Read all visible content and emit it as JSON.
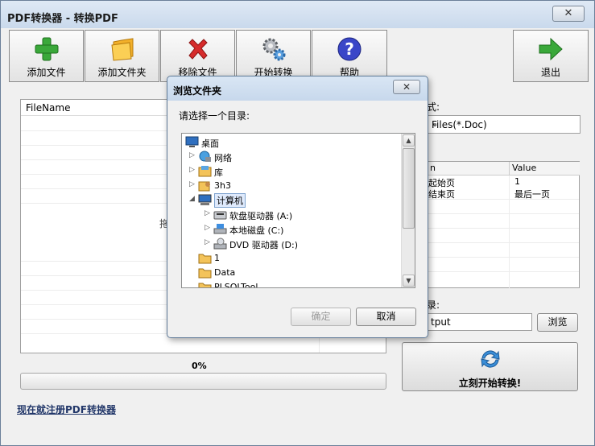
{
  "window": {
    "title": "PDF转换器 - 转换PDF",
    "close_glyph": "✕"
  },
  "toolbar": {
    "add_file": "添加文件",
    "add_folder": "添加文件夹",
    "remove_file": "移除文件",
    "start_convert": "开始转换",
    "help": "帮助",
    "exit": "退出"
  },
  "file_list": {
    "header": "FileName",
    "drop_hint": "拖"
  },
  "progress": {
    "percent_label": "0%",
    "value": 0
  },
  "register_link": "现在就注册PDF转换器",
  "format": {
    "label": "式:",
    "selected": "Files(*.Doc)"
  },
  "properties": {
    "col_name": "n",
    "col_value": "Value",
    "rows": [
      {
        "name": "起始页",
        "value": "1"
      },
      {
        "name": "结束页",
        "value": "最后一页"
      }
    ]
  },
  "output": {
    "label": "录:",
    "value": "tput",
    "browse": "浏览"
  },
  "start_button": "立刻开始转换!",
  "dialog": {
    "title": "浏览文件夹",
    "close_glyph": "✕",
    "prompt": "请选择一个目录:",
    "tree": [
      {
        "label": "桌面",
        "icon": "desktop-icon",
        "expander": ""
      },
      {
        "label": "网络",
        "icon": "network-icon",
        "expander": "▷"
      },
      {
        "label": "库",
        "icon": "library-icon",
        "expander": "▷"
      },
      {
        "label": "3h3",
        "icon": "user-folder-icon",
        "expander": "▷"
      },
      {
        "label": "计算机",
        "icon": "computer-icon",
        "expander": "◢"
      },
      {
        "label": "软盘驱动器 (A:)",
        "icon": "floppy-icon",
        "expander": "▷"
      },
      {
        "label": "本地磁盘 (C:)",
        "icon": "disk-icon",
        "expander": "▷"
      },
      {
        "label": "DVD 驱动器 (D:)",
        "icon": "dvd-icon",
        "expander": "▷"
      },
      {
        "label": "1",
        "icon": "folder-icon",
        "expander": ""
      },
      {
        "label": "Data",
        "icon": "folder-icon",
        "expander": ""
      },
      {
        "label": "PLSQLTool",
        "icon": "folder-icon",
        "expander": ""
      }
    ],
    "ok": "确定",
    "cancel": "取消"
  },
  "colors": {
    "accent": "#3e7fd0",
    "green": "#2e9c2e",
    "red": "#d32a2a"
  }
}
